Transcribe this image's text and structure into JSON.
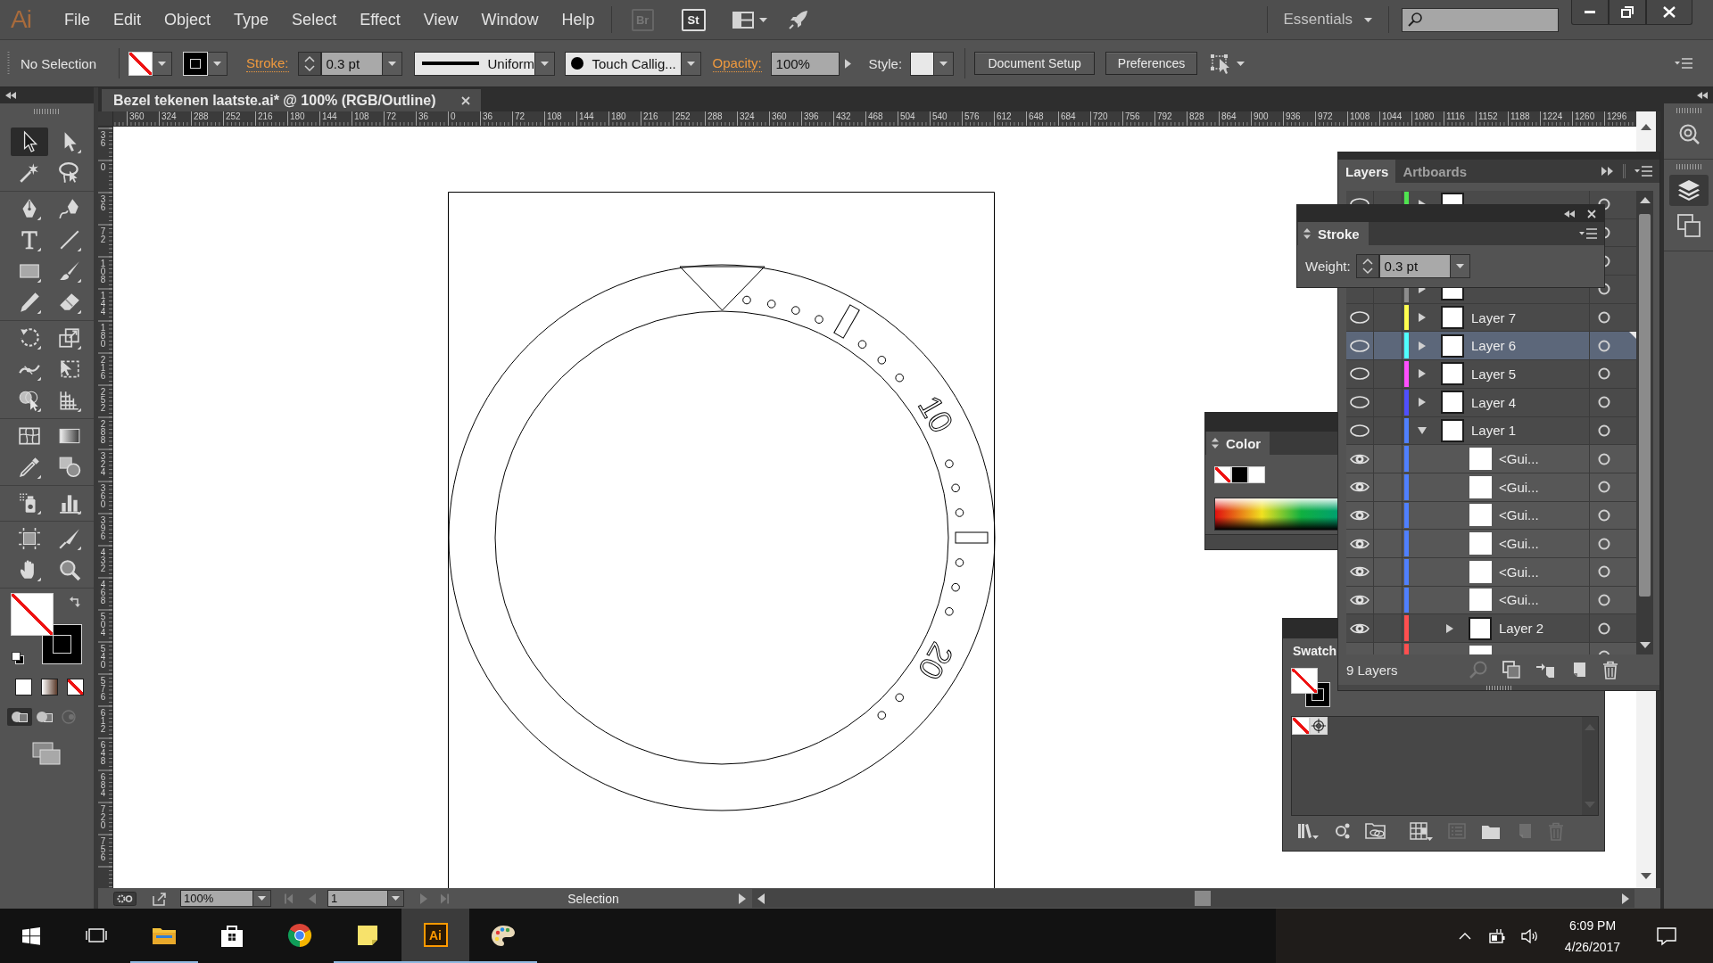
{
  "menu_bar": {
    "logo": "Ai",
    "menus": [
      "File",
      "Edit",
      "Object",
      "Type",
      "Select",
      "Effect",
      "View",
      "Window",
      "Help"
    ],
    "app_buttons": [
      {
        "kind": "bridge",
        "label": "Br",
        "disabled": true
      },
      {
        "kind": "stock",
        "label": "St",
        "disabled": false
      },
      {
        "kind": "arrange"
      },
      {
        "kind": "gpu"
      }
    ],
    "workspace": "Essentials"
  },
  "control_bar": {
    "selection": "No Selection",
    "fill": {
      "kind": "none"
    },
    "stroke": {
      "kind": "color",
      "color": "#000000"
    },
    "stroke_label": "Stroke:",
    "stroke_weight": "0.3 pt",
    "profile": "Uniform",
    "brush": "Touch Callig...",
    "opacity_label": "Opacity:",
    "opacity": "100%",
    "style_label": "Style:",
    "buttons": [
      "Document Setup",
      "Preferences"
    ]
  },
  "document_tab": {
    "title": "Bezel tekenen laatste.ai* @ 100% (RGB/Outline)"
  },
  "tools": {
    "groups": [
      {
        "tools": [
          {
            "kind": "selection",
            "selected": true
          },
          {
            "kind": "direct-selection",
            "selected": false
          },
          {
            "kind": "magic-wand",
            "selected": false
          },
          {
            "kind": "lasso",
            "selected": false
          }
        ]
      },
      {
        "tools": [
          {
            "kind": "pen",
            "selected": false
          },
          {
            "kind": "curvature",
            "selected": false
          },
          {
            "kind": "type",
            "selected": false
          },
          {
            "kind": "line",
            "selected": false
          },
          {
            "kind": "rectangle",
            "selected": false
          },
          {
            "kind": "paintbrush",
            "selected": false
          },
          {
            "kind": "pencil",
            "selected": false
          },
          {
            "kind": "eraser",
            "selected": false
          }
        ]
      },
      {
        "tools": [
          {
            "kind": "rotate",
            "selected": false
          },
          {
            "kind": "scale",
            "selected": false
          },
          {
            "kind": "width",
            "selected": false
          },
          {
            "kind": "free-transform",
            "selected": false
          },
          {
            "kind": "shape-builder",
            "selected": false
          },
          {
            "kind": "perspective-grid",
            "selected": false
          }
        ]
      },
      {
        "tools": [
          {
            "kind": "mesh",
            "selected": false
          },
          {
            "kind": "gradient",
            "selected": false
          },
          {
            "kind": "eyedropper",
            "selected": false
          },
          {
            "kind": "blend",
            "selected": false
          }
        ]
      },
      {
        "tools": [
          {
            "kind": "symbol-sprayer",
            "selected": false
          },
          {
            "kind": "column-graph",
            "selected": false
          }
        ]
      },
      {
        "tools": [
          {
            "kind": "artboard",
            "selected": false
          },
          {
            "kind": "slice",
            "selected": false
          },
          {
            "kind": "hand",
            "selected": false
          },
          {
            "kind": "zoom",
            "selected": false
          }
        ]
      }
    ],
    "fill": {
      "kind": "none"
    },
    "stroke": {
      "kind": "color",
      "color": "#000000"
    },
    "paint_modes": [
      {
        "kind": "color"
      },
      {
        "kind": "gradient"
      },
      {
        "kind": "none"
      }
    ],
    "draw_modes": [
      {
        "kind": "normal",
        "selected": true,
        "disabled": false
      },
      {
        "kind": "behind",
        "selected": false,
        "disabled": false
      },
      {
        "kind": "inside",
        "selected": false,
        "disabled": true
      }
    ]
  },
  "rulers": {
    "horizontal": [
      "360",
      "324",
      "288",
      "252",
      "216",
      "180",
      "144",
      "108",
      "72",
      "36",
      "0",
      "36",
      "72",
      "108",
      "144",
      "180",
      "216",
      "252",
      "288",
      "324",
      "360",
      "396",
      "432",
      "468",
      "504",
      "540",
      "576",
      "612",
      "648",
      "684",
      "720",
      "756",
      "792",
      "828",
      "864",
      "900",
      "936",
      "972",
      "1008",
      "1044",
      "1080",
      "1116",
      "1152",
      "1188",
      "1224",
      "1260",
      "1296"
    ],
    "vertical": [
      "36",
      "0",
      "36",
      "72",
      "108",
      "144",
      "180",
      "216",
      "252",
      "288",
      "324",
      "360",
      "396",
      "432",
      "468",
      "504",
      "540",
      "576",
      "612",
      "648",
      "684",
      "720",
      "756"
    ]
  },
  "artwork": {
    "numerals": [
      "10",
      "20"
    ]
  },
  "layers_panel": {
    "tabs": [
      {
        "label": "Layers",
        "selected": true
      },
      {
        "label": "Artboards",
        "selected": false
      }
    ],
    "rows": [
      {
        "kind": "layer",
        "color": "#4fe44f",
        "visible": true,
        "outline": true,
        "expanded": false,
        "selected": false
      },
      {
        "kind": "layer"
      },
      {
        "kind": "layer"
      },
      {
        "kind": "layer",
        "color": "#8c8c8c",
        "expanded": false,
        "selected": false
      },
      {
        "kind": "layer",
        "name": "Layer 7",
        "color": "#ffff4f",
        "visible": true,
        "outline": true,
        "expanded": false,
        "selected": false
      },
      {
        "kind": "layer",
        "name": "Layer 6",
        "color": "#4fffff",
        "visible": true,
        "outline": true,
        "expanded": false,
        "selected": true
      },
      {
        "kind": "layer",
        "name": "Layer 5",
        "color": "#ff4fff",
        "visible": true,
        "outline": true,
        "expanded": false,
        "selected": false
      },
      {
        "kind": "layer",
        "name": "Layer 4",
        "color": "#4f4fff",
        "visible": true,
        "outline": true,
        "expanded": false,
        "selected": false
      },
      {
        "kind": "layer",
        "name": "Layer 1",
        "color": "#4f80ff",
        "visible": true,
        "outline": true,
        "expanded": true,
        "selected": false,
        "children": [
          {
            "kind": "object",
            "name": "<Gui...",
            "color": "#4f80ff",
            "visible": true,
            "outline": false,
            "selected": false
          },
          {
            "kind": "object",
            "name": "<Gui...",
            "color": "#4f80ff",
            "visible": true,
            "outline": false,
            "selected": false
          },
          {
            "kind": "object",
            "name": "<Gui...",
            "color": "#4f80ff",
            "visible": true,
            "outline": false,
            "selected": false
          },
          {
            "kind": "object",
            "name": "<Gui...",
            "color": "#4f80ff",
            "visible": true,
            "outline": false,
            "selected": false
          },
          {
            "kind": "object",
            "name": "<Gui...",
            "color": "#4f80ff",
            "visible": true,
            "outline": false,
            "selected": false
          },
          {
            "kind": "object",
            "name": "<Gui...",
            "color": "#4f80ff",
            "visible": true,
            "outline": false,
            "selected": false
          },
          {
            "kind": "layer",
            "name": "Layer 2",
            "color": "#ff4f4f",
            "visible": true,
            "outline": false,
            "expanded": false,
            "selected": false
          },
          {
            "kind": "object",
            "color": "#ff4f4f",
            "selected": false
          }
        ]
      }
    ],
    "footer": "9 Layers",
    "footer_buttons": [
      {
        "kind": "locate",
        "disabled": true
      },
      {
        "kind": "clip",
        "disabled": false
      },
      {
        "kind": "sublayer",
        "disabled": false
      },
      {
        "kind": "new",
        "disabled": false
      },
      {
        "kind": "delete",
        "disabled": false
      }
    ]
  },
  "stroke_panel": {
    "title": "Stroke",
    "weight_label": "Weight:",
    "weight": "0.3 pt"
  },
  "color_panel": {
    "title": "Color",
    "swatches": [
      {
        "kind": "none"
      },
      {
        "kind": "color",
        "color": "#000000"
      },
      {
        "kind": "color",
        "color": "#ffffff"
      }
    ]
  },
  "swatches_panel": {
    "title": "Swatch",
    "fill": {
      "kind": "none"
    },
    "stroke": {
      "kind": "color",
      "color": "#000000"
    },
    "swatches": [
      {
        "kind": "none"
      },
      {
        "kind": "registration"
      }
    ],
    "footer_buttons": [
      {
        "kind": "library",
        "disabled": false
      },
      {
        "kind": "cc-library",
        "disabled": false
      },
      {
        "kind": "link-folder",
        "disabled": false
      },
      {
        "kind": "kinds",
        "disabled": false
      },
      {
        "kind": "options",
        "disabled": true
      },
      {
        "kind": "group",
        "disabled": false
      },
      {
        "kind": "new",
        "disabled": true
      },
      {
        "kind": "delete",
        "disabled": true
      }
    ]
  },
  "dock": {
    "groups": [
      {
        "items": [
          {
            "kind": "libraries",
            "selected": false
          }
        ]
      },
      {
        "items": [
          {
            "kind": "layers",
            "selected": true
          },
          {
            "kind": "artboards",
            "selected": false
          }
        ]
      }
    ]
  },
  "status_bar": {
    "zoom": "100%",
    "artboard": "1",
    "tool": "Selection"
  },
  "taskbar": {
    "apps": [
      {
        "kind": "explorer",
        "running": true,
        "selected": false
      },
      {
        "kind": "store",
        "running": false,
        "selected": false
      },
      {
        "kind": "chrome",
        "running": false,
        "selected": false
      },
      {
        "kind": "notes",
        "running": true,
        "selected": false
      },
      {
        "kind": "illustrator",
        "label": "Ai",
        "running": true,
        "selected": true
      },
      {
        "kind": "paint",
        "running": true,
        "selected": false
      }
    ],
    "time": "6:09 PM",
    "date": "4/26/2017"
  }
}
